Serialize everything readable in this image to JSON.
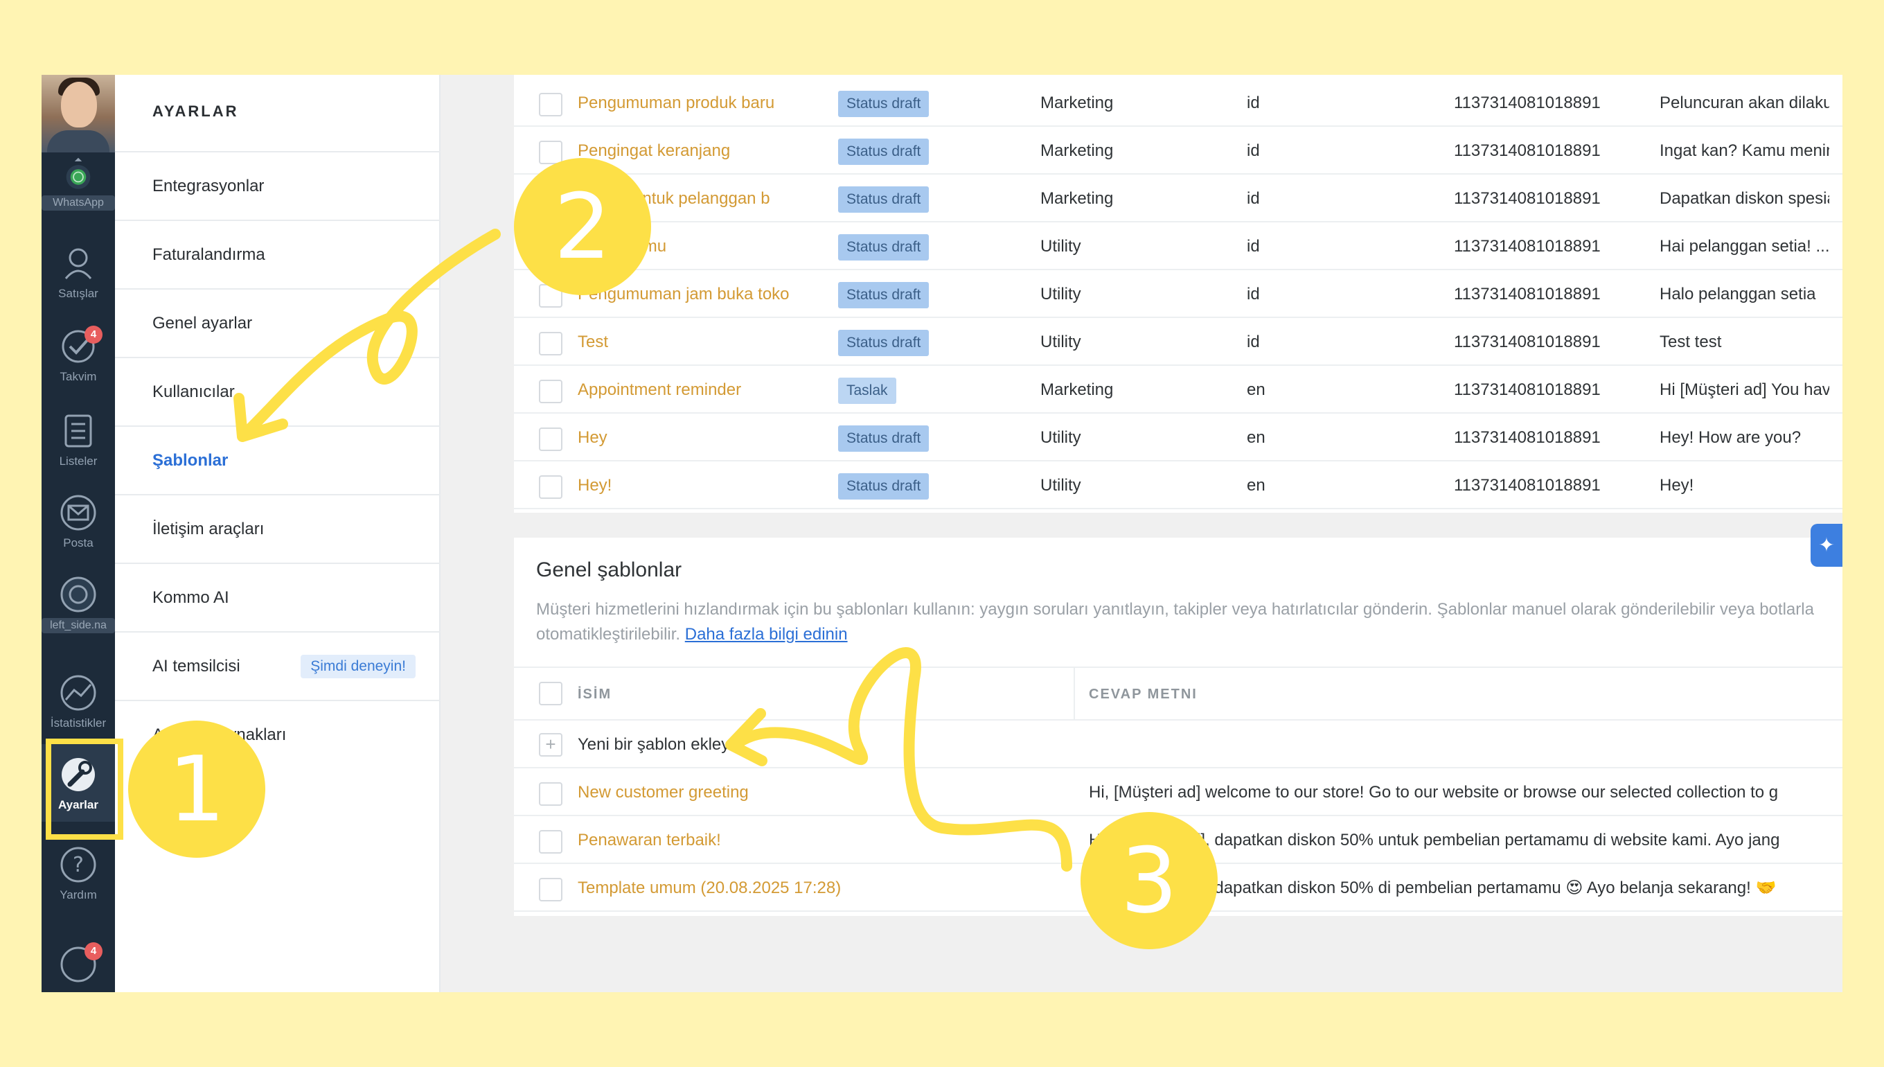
{
  "rail": {
    "items": [
      {
        "label": "WhatsApp"
      },
      {
        "label": "Satışlar"
      },
      {
        "label": "Takvim",
        "badge": "4"
      },
      {
        "label": "Listeler"
      },
      {
        "label": "Posta"
      },
      {
        "label": "left_side.na"
      },
      {
        "label": "İstatistikler"
      },
      {
        "label": "Ayarlar"
      },
      {
        "label": "Yardım"
      },
      {
        "label": "",
        "badge": "4"
      }
    ]
  },
  "menu": {
    "title": "AYARLAR",
    "items": [
      {
        "label": "Entegrasyonlar"
      },
      {
        "label": "Faturalandırma"
      },
      {
        "label": "Genel ayarlar"
      },
      {
        "label": "Kullanıcılar"
      },
      {
        "label": "Şablonlar"
      },
      {
        "label": "İletişim araçları"
      },
      {
        "label": "Kommo AI"
      },
      {
        "label": "AI temsilcisi",
        "badge": "Şimdi deneyin!"
      },
      {
        "label": "Aranan kaynakları"
      }
    ]
  },
  "templates": {
    "rows": [
      {
        "name": "Pengumuman produk baru",
        "status": "Status draft",
        "category": "Marketing",
        "lang": "id",
        "account": "1137314081018891",
        "text": "Peluncuran akan dilakukan"
      },
      {
        "name": "Pengingat keranjang",
        "status": "Status draft",
        "category": "Marketing",
        "lang": "id",
        "account": "1137314081018891",
        "text": "Ingat kan? Kamu menin"
      },
      {
        "name": "Diskon untuk pelanggan b",
        "status": "Status draft",
        "category": "Marketing",
        "lang": "id",
        "account": "1137314081018891",
        "text": "Dapatkan diskon spesial"
      },
      {
        "name": "Pesananmu",
        "status": "Status draft",
        "category": "Utility",
        "lang": "id",
        "account": "1137314081018891",
        "text": "Hai pelanggan setia! ..."
      },
      {
        "name": "Pengumuman jam buka toko",
        "status": "Status draft",
        "category": "Utility",
        "lang": "id",
        "account": "1137314081018891",
        "text": "Halo pelanggan setia"
      },
      {
        "name": "Test",
        "status": "Status draft",
        "category": "Utility",
        "lang": "id",
        "account": "1137314081018891",
        "text": "Test test"
      },
      {
        "name": "Appointment reminder",
        "status": "Taslak",
        "category": "Marketing",
        "lang": "en",
        "account": "1137314081018891",
        "text": "Hi [Müşteri ad] You have"
      },
      {
        "name": "Hey",
        "status": "Status draft",
        "category": "Utility",
        "lang": "en",
        "account": "1137314081018891",
        "text": "Hey! How are you?"
      },
      {
        "name": "Hey!",
        "status": "Status draft",
        "category": "Utility",
        "lang": "en",
        "account": "1137314081018891",
        "text": "Hey!"
      }
    ]
  },
  "general": {
    "title": "Genel şablonlar",
    "description": "Müşteri hizmetlerini hızlandırmak için bu şablonları kullanın: yaygın soruları yanıtlayın, takipler veya hatırlatıcılar gönderin. Şablonlar manuel olarak gönderilebilir veya botlarla otomatikleştirilebilir.",
    "link": "Daha fazla bilgi edinin",
    "header_name": "İSİM",
    "header_text": "CEVAP METNI",
    "add_label": "Yeni bir şablon ekleyin",
    "rows": [
      {
        "name": "New customer greeting",
        "text": "Hi, [Müşteri ad] welcome to our store! Go to our website or browse our selected collection to g"
      },
      {
        "name": "Penawaran terbaik!",
        "text": "Hai [Müşteri ad], dapatkan diskon 50% untuk pembelian pertamamu di website kami. Ayo jang"
      },
      {
        "name": "Template umum (20.08.2025 17:28)",
        "text": "Hai [Müşteri ad], dapatkan diskon 50% di pembelian pertamamu 😍 Ayo belanja sekarang! 🤝"
      }
    ]
  },
  "callouts": {
    "one": "1",
    "two": "2",
    "three": "3",
    "color": "#fde047"
  },
  "colors": {
    "background": "#fff4b3",
    "rail": "#1d2b3a",
    "accent": "#2b6fd6",
    "template_name": "#d39a34",
    "status_chip": "#a8c9ef"
  }
}
